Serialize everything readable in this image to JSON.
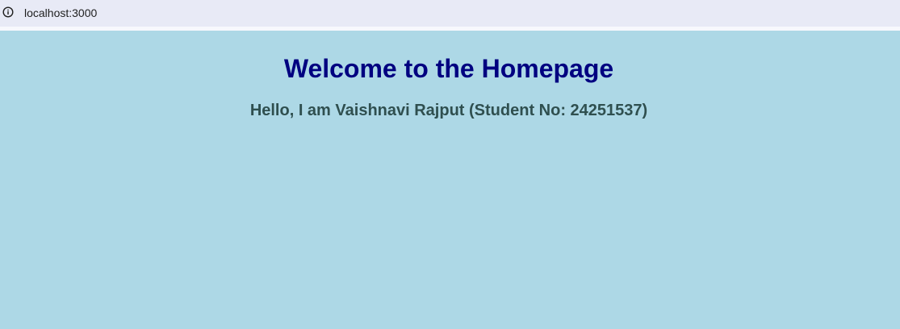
{
  "browser": {
    "url": "localhost:3000",
    "info_icon": "info-circle-icon"
  },
  "page": {
    "title": "Welcome to the Homepage",
    "subtitle": "Hello, I am Vaishnavi Rajput (Student No: 24251537)"
  },
  "colors": {
    "page_background": "#add8e6",
    "title": "#000080",
    "subtitle": "#2f4f4f",
    "address_bar": "#e8eaf6"
  }
}
